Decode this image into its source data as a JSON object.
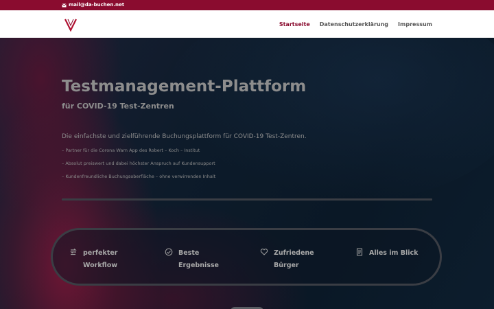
{
  "topbar": {
    "email": "mail@da-buchen.net",
    "email_icon": "envelope-icon"
  },
  "header": {
    "logo_letter": "V",
    "nav": [
      {
        "label": "Startseite",
        "active": true
      },
      {
        "label": "Datenschutzerklärung",
        "active": false
      },
      {
        "label": "Impressum",
        "active": false
      }
    ]
  },
  "hero": {
    "title": "Testmanagement-Plattform",
    "subtitle": "für COVID-19 Test-Zentren",
    "intro": "Die einfachste und zielführende Buchungsplattform für COVID-19 Test-Zentren.",
    "bullets": [
      "– Partner für die Corona Warn App des Robert – Koch – Institut",
      "– Absolut preiswert und dabei höchster Anspruch auf Kundensupport",
      "– Kundenfreundliche Buchungsoberfläche – ohne verwirrenden Inhalt"
    ]
  },
  "features": [
    {
      "icon": "workflow-icon",
      "line1": "perfekter",
      "line2": "Workflow"
    },
    {
      "icon": "check-circle-icon",
      "line1": "Beste",
      "line2": "Ergebnisse"
    },
    {
      "icon": "heart-icon",
      "line1": "Zufriedene",
      "line2": "Bürger"
    },
    {
      "icon": "document-icon",
      "line1": "Alles im Blick",
      "line2": ""
    }
  ],
  "colors": {
    "brand": "#8a0c2f",
    "nav_text": "#555555",
    "hero_bg": "#0d1b2a",
    "hero_text": "#8d8d8d"
  }
}
